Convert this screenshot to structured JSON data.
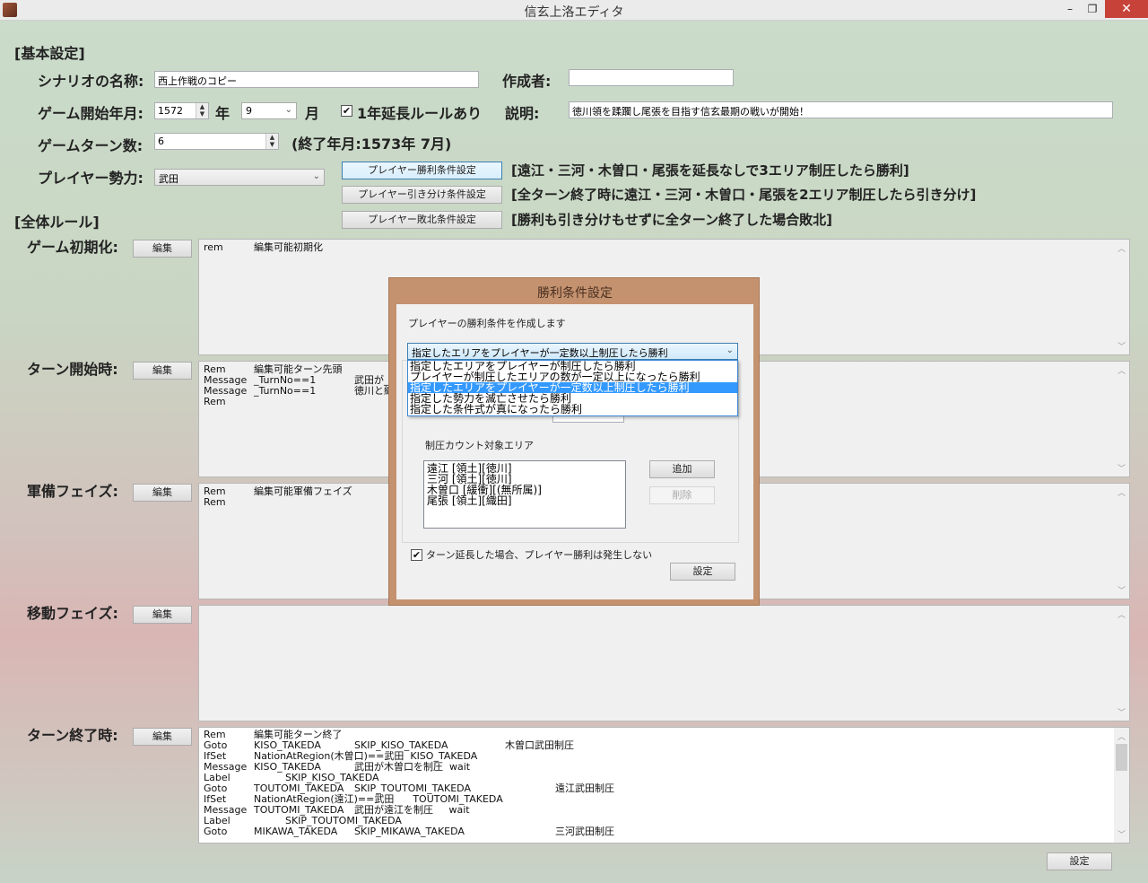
{
  "window": {
    "title": "信玄上洛エディタ",
    "minimize": "–",
    "restore": "❐",
    "close": "✕"
  },
  "basic": {
    "section": "[基本設定]",
    "scenario_label": "シナリオの名称:",
    "scenario_value": "西上作戦のコピー",
    "author_label": "作成者:",
    "author_value": "",
    "start_label": "ゲーム開始年月:",
    "year_value": "1572",
    "year_unit": "年",
    "month_value": "9",
    "month_unit": "月",
    "extension_label": "1年延長ルールあり",
    "extension_checked": true,
    "desc_label": "説明:",
    "desc_value": "徳川領を蹂躙し尾張を目指す信玄最期の戦いが開始！",
    "turns_label": "ゲームターン数:",
    "turns_value": "6",
    "end_date": "(終了年月:1573年 7月)",
    "faction_label": "プレイヤー勢力:",
    "faction_value": "武田"
  },
  "conditions": [
    {
      "button": "プレイヤー勝利条件設定",
      "text": "[遠江・三河・木曽口・尾張を延長なしで3エリア制圧したら勝利]"
    },
    {
      "button": "プレイヤー引き分け条件設定",
      "text": "[全ターン終了時に遠江・三河・木曽口・尾張を2エリア制圧したら引き分け]"
    },
    {
      "button": "プレイヤー敗北条件設定",
      "text": "[勝利も引き分けもせずに全ターン終了した場合敗北]"
    }
  ],
  "rules": {
    "section": "[全体ルール]",
    "edit_label": "編集",
    "phases": [
      {
        "label": "ゲーム初期化:",
        "lines": [
          [
            "rem",
            "編集可能初期化",
            "",
            ""
          ]
        ]
      },
      {
        "label": "ターン開始時:",
        "lines": [
          [
            "Rem",
            "編集可能ターン先頭",
            "",
            ""
          ],
          [
            "Message",
            "_TurnNo==1",
            "武田が_",
            ""
          ],
          [
            "Message",
            "_TurnNo==1",
            "徳川と織",
            ""
          ],
          [
            "Rem",
            "",
            "",
            ""
          ]
        ]
      },
      {
        "label": "軍備フェイズ:",
        "lines": [
          [
            "Rem",
            "編集可能軍備フェイズ",
            "",
            ""
          ],
          [
            "Rem",
            "",
            "",
            ""
          ]
        ]
      },
      {
        "label": "移動フェイズ:",
        "lines": []
      },
      {
        "label": "ターン終了時:",
        "lines": [
          [
            "Rem",
            "編集可能ターン終了",
            "",
            ""
          ],
          [
            "Goto",
            "KISO_TAKEDA",
            "SKIP_KISO_TAKEDA",
            "木曽口武田制圧"
          ],
          [
            "IfSet",
            "NationAtRegion(木曽口)==武田  KISO_TAKEDA",
            "",
            ""
          ],
          [
            "Message",
            "KISO_TAKEDA",
            "武田が木曽口を制圧  wait",
            ""
          ],
          [
            "Label",
            "          SKIP_KISO_TAKEDA",
            "",
            ""
          ],
          [
            "Goto",
            "TOUTOMI_TAKEDA",
            "SKIP_TOUTOMI_TAKEDA",
            "遠江武田制圧"
          ],
          [
            "IfSet",
            "NationAtRegion(遠江)==武田      TOUTOMI_TAKEDA",
            "",
            ""
          ],
          [
            "Message",
            "TOUTOMI_TAKEDA",
            "武田が遠江を制圧     wait",
            ""
          ],
          [
            "Label",
            "          SKIP_TOUTOMI_TAKEDA",
            "",
            ""
          ],
          [
            "Goto",
            "MIKAWA_TAKEDA",
            "SKIP_MIKAWA_TAKEDA",
            "三河武田制圧"
          ]
        ]
      }
    ]
  },
  "footer": {
    "set_button": "設定"
  },
  "dialog": {
    "title": "勝利条件設定",
    "intro": "プレイヤーの勝利条件を作成します",
    "selected": "指定したエリアをプレイヤーが一定数以上制圧したら勝利",
    "options": [
      "指定したエリアをプレイヤーが制圧したら勝利",
      "プレイヤーが制圧したエリアの数が一定以上になったら勝利",
      "指定したエリアをプレイヤーが一定数以上制圧したら勝利",
      "指定した勢力を滅亡させたら勝利",
      "指定した条件式が真になったら勝利"
    ],
    "area_label": "制圧カウント対象エリア",
    "areas": [
      "遠江 [領土][徳川]",
      "三河 [領土][徳川]",
      "木曽口 [緩衝][(無所属)]",
      "尾張 [領土][織田]"
    ],
    "add": "追加",
    "remove": "削除",
    "no_win_on_extension": "ターン延長した場合、プレイヤー勝利は発生しない",
    "no_win_checked": true,
    "set": "設定"
  },
  "colors": {
    "dialog_frame": "#c4926f",
    "selection": "#3399ff",
    "close": "#c7433a"
  }
}
